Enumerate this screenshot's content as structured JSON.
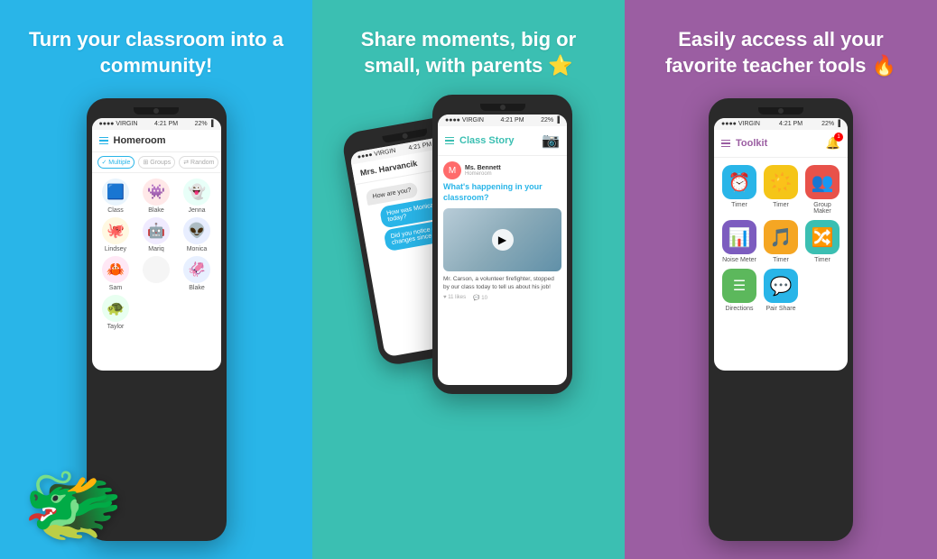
{
  "panels": [
    {
      "id": "panel-blue",
      "bg": "#29b5e8",
      "headline": "Turn your classroom into a community!",
      "phone": {
        "status_left": "●●●●● VIRGIN ▾",
        "status_time": "4:21 PM",
        "status_right": "22% ▐",
        "header_title": "Homeroom",
        "tabs": [
          "Multiple",
          "Groups",
          "Random"
        ],
        "students": [
          {
            "name": "Class",
            "emoji": "🟦",
            "color": "#29b5e8"
          },
          {
            "name": "Blake",
            "emoji": "👾",
            "color": "#ff6b6b"
          },
          {
            "name": "Jenna",
            "emoji": "👻",
            "color": "#4ecdc4"
          },
          {
            "name": "Lindsey",
            "emoji": "🐙",
            "color": "#f9ca24"
          },
          {
            "name": "Mariq",
            "emoji": "🤖",
            "color": "#6c5ce7"
          },
          {
            "name": "Monica",
            "emoji": "👽",
            "color": "#a29bfe"
          },
          {
            "name": "Sam",
            "emoji": "🦀",
            "color": "#fd79a8"
          },
          {
            "name": "",
            "emoji": "",
            "color": ""
          },
          {
            "name": "Blake",
            "emoji": "🦑",
            "color": "#0984e3"
          },
          {
            "name": "Taylor",
            "emoji": "🐢",
            "color": "#00b894"
          }
        ]
      }
    },
    {
      "id": "panel-teal",
      "bg": "#3bbfb2",
      "headline": "Share moments, big or small, with parents ⭐",
      "phone_back": {
        "header_title": "Mrs. Harvancik",
        "messages": [
          {
            "type": "them",
            "text": "How are you?"
          },
          {
            "type": "me",
            "text": "How was Monica in class today?"
          },
          {
            "type": "me",
            "text": "Did you notice any changes since last..."
          }
        ]
      },
      "phone_front": {
        "status_left": "●●●●● VIRGIN ▾",
        "status_time": "4:21 PM",
        "status_right": "22% ▐",
        "header_title": "Class Story",
        "post": {
          "author": "Ms. Bennett",
          "location": "Homeroom",
          "question": "What's happening in your classroom?",
          "story_text": "Mr. Carson, a volunteer firefighter, stopped by our class today to tell us about his job!",
          "likes": "11 likes",
          "comments": "10"
        }
      }
    },
    {
      "id": "panel-purple",
      "bg": "#9b5ea2",
      "headline": "Easily access all your favorite teacher tools 🔥",
      "phone": {
        "status_left": "●●●●● VIRGIN ▾",
        "status_time": "4:21 PM",
        "status_right": "22% ▐",
        "header_title": "Toolkit",
        "tools": [
          {
            "label": "Timer",
            "icon": "⏰",
            "color": "#29b5e8"
          },
          {
            "label": "Timer",
            "icon": "✨",
            "color": "#f5c518"
          },
          {
            "label": "Group Maker",
            "icon": "👥",
            "color": "#e8524a"
          },
          {
            "label": "Noise Meter",
            "icon": "📊",
            "color": "#7c5cbf"
          },
          {
            "label": "Timer",
            "icon": "🎵",
            "color": "#f5a623"
          },
          {
            "label": "Timer",
            "icon": "🔀",
            "color": "#3bbfb2"
          },
          {
            "label": "Directions",
            "icon": "☰",
            "color": "#5cb85c"
          },
          {
            "label": "Pair Share",
            "icon": "💬",
            "color": "#29b5e8"
          }
        ]
      }
    }
  ]
}
